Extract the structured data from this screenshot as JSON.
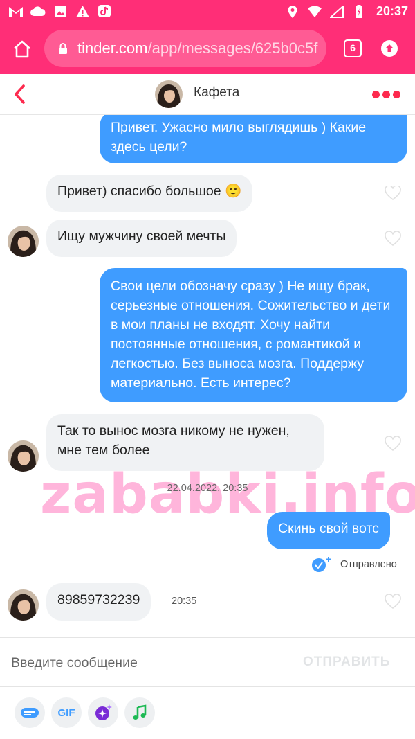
{
  "status_bar": {
    "time": "20:37",
    "left_icons": [
      "gmail-icon",
      "cloud-icon",
      "image-icon",
      "warning-icon",
      "tiktok-icon"
    ],
    "right_icons": [
      "location-icon",
      "wifi-icon",
      "signal-icon",
      "battery-icon"
    ]
  },
  "browser": {
    "url_host": "tinder.com",
    "url_path": "/app/messages/625b0c5f",
    "tab_count": "6"
  },
  "chat_header": {
    "name": "Кафета"
  },
  "messages": [
    {
      "side": "out",
      "text": "Привет. Ужасно мило выглядишь ) Какие здесь цели?"
    },
    {
      "side": "in",
      "text": "Привет) спасибо большое 🙂"
    },
    {
      "side": "in",
      "text": "Ищу мужчину своей мечты"
    },
    {
      "side": "out",
      "text": "Свои цели обозначу сразу ) Не ищу брак, серьезные отношения. Сожительство и дети в мои планы не входят. Хочу найти постоянные отношения, с романтикой и легкостью. Без выноса мозга. Поддержу материально. Есть интерес?"
    },
    {
      "side": "in",
      "text": "Так то вынос мозга никому не нужен, мне тем более"
    },
    {
      "side": "out",
      "text": "Скинь свой вотс"
    },
    {
      "side": "in",
      "text": "89859732239"
    }
  ],
  "date_separator": "22.04.2022, 20:35",
  "sent_status": "Отправлено",
  "last_message_time": "20:35",
  "watermark": "zababki.info",
  "composer": {
    "placeholder": "Введите сообщение",
    "send_label": "ОТПРАВИТЬ"
  },
  "toolbar": {
    "gif_label": "GIF"
  },
  "colors": {
    "brand": "#ff2e77",
    "outgoing": "#3f9cff",
    "incoming": "#f0f2f4",
    "accent": "#fd2a4e"
  }
}
